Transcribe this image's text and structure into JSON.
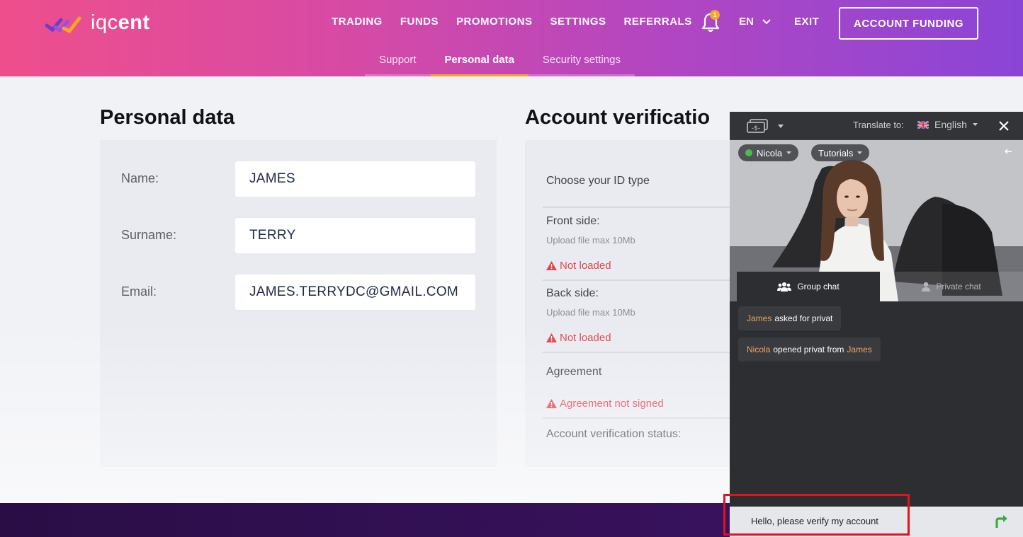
{
  "header": {
    "logo_text": "iqcent",
    "nav": [
      "TRADING",
      "FUNDS",
      "PROMOTIONS",
      "SETTINGS",
      "REFERRALS"
    ],
    "notifications_count": "1",
    "language": "EN",
    "exit_label": "EXIT",
    "account_funding_label": "ACCOUNT FUNDING"
  },
  "subnav": {
    "tabs": [
      "Support",
      "Personal data",
      "Security settings"
    ],
    "active": "Personal data"
  },
  "personal": {
    "title": "Personal data",
    "name_label": "Name:",
    "name_value": "JAMES",
    "surname_label": "Surname:",
    "surname_value": "TERRY",
    "email_label": "Email:",
    "email_value": "JAMES.TERRYDC@GMAIL.COM"
  },
  "verification": {
    "title": "Account verificatio",
    "id_type_label": "Choose your ID type",
    "front_label": "Front side:",
    "front_hint": "Upload file max 10Mb",
    "front_status": "Not loaded",
    "back_label": "Back side:",
    "back_hint": "Upload file max 10Mb",
    "back_status": "Not loaded",
    "agreement_label": "Agreement",
    "agreement_status": "Agreement not signed",
    "status_label": "Account verification status:"
  },
  "chat": {
    "translate_label": "Translate to:",
    "translate_lang": "English",
    "agent_name": "Nicola",
    "tutorials_label": "Tutorials",
    "group_chat_label": "Group chat",
    "private_chat_label": "Private chat",
    "messages": [
      {
        "name": "James",
        "text": "asked for privat"
      },
      {
        "name": "Nicola",
        "text": "opened privat from",
        "name2": "James"
      }
    ],
    "input_value": "Hello, please verify my account",
    "colors": {
      "online": "#47c04a",
      "send": "#3ea846",
      "highlight": "#e0141c"
    }
  }
}
